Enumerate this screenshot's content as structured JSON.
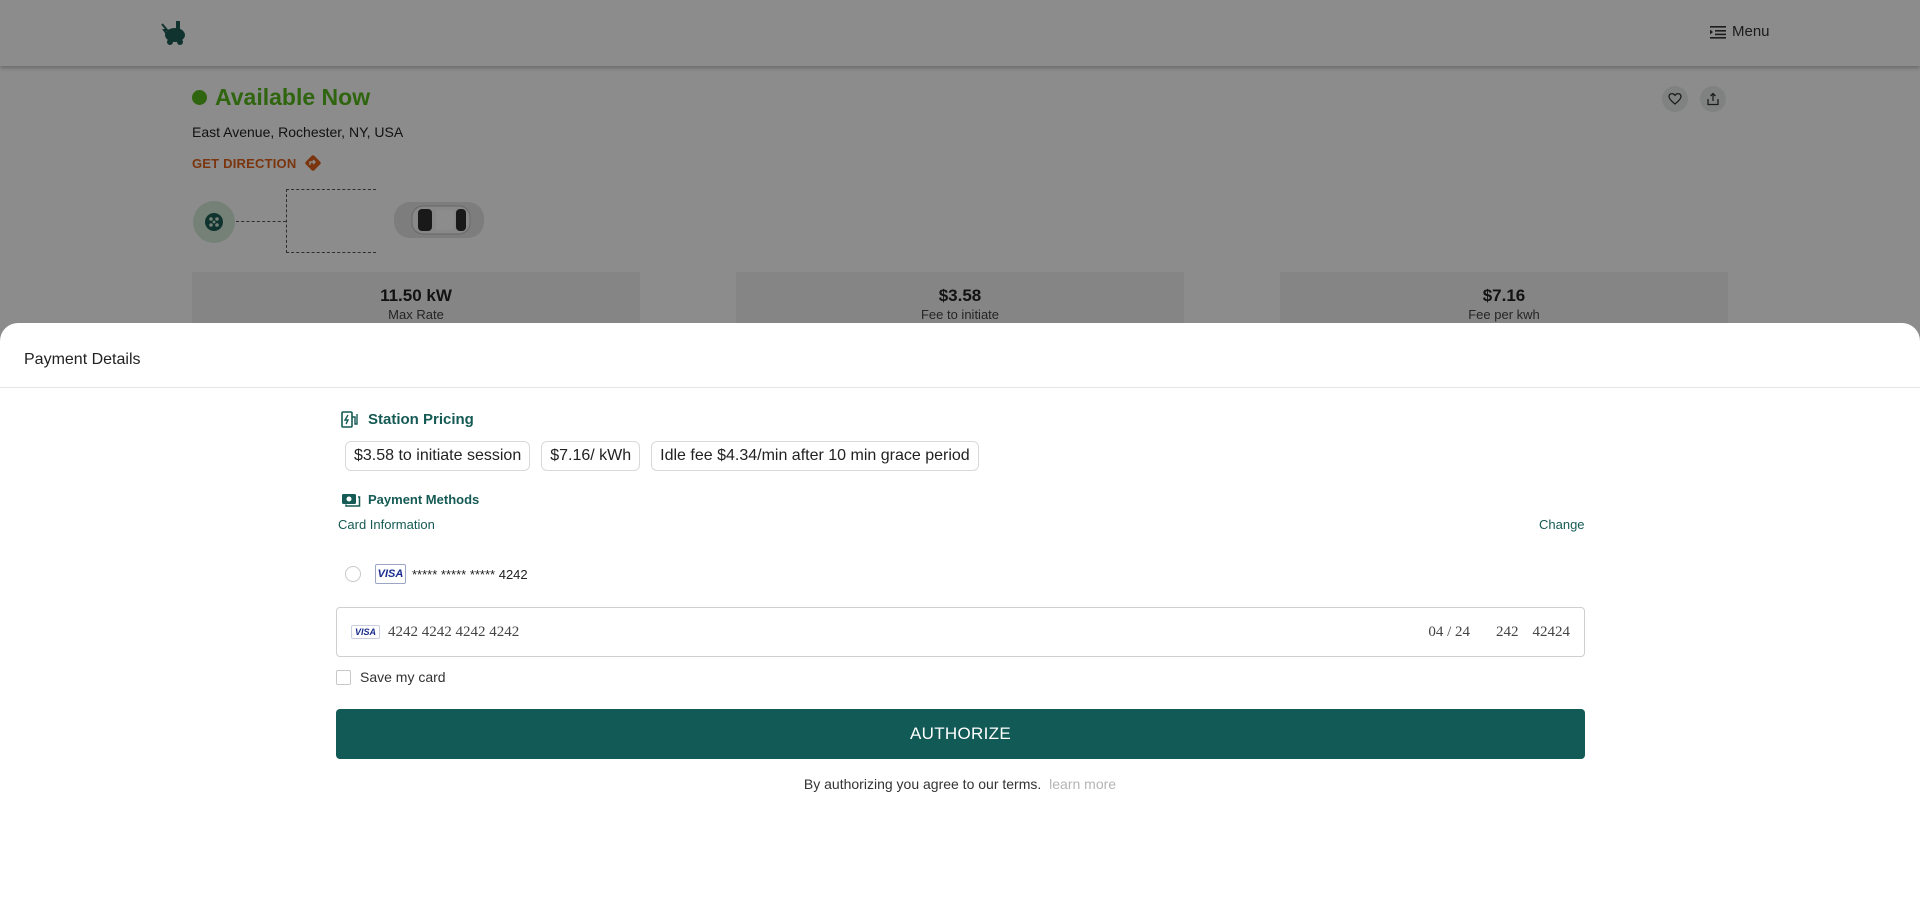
{
  "header": {
    "menu_label": "Menu",
    "icons": {
      "logo": "ev-charger-logo",
      "menu": "menu-lines-icon"
    }
  },
  "station": {
    "status": "Available Now",
    "address": "East Avenue, Rochester, NY, USA",
    "direction_label": "GET DIRECTION",
    "stats": [
      {
        "value": "11.50 kW",
        "label": "Max Rate"
      },
      {
        "value": "$3.58",
        "label": "Fee to initiate"
      },
      {
        "value": "$7.16",
        "label": "Fee per kwh"
      }
    ]
  },
  "payment": {
    "title": "Payment Details",
    "pricing_title": "Station Pricing",
    "pricing_chips": [
      "$3.58 to initiate session",
      "$7.16/ kWh",
      "Idle fee $4.34/min after 10 min grace period"
    ],
    "methods_title": "Payment Methods",
    "card_info_label": "Card Information",
    "change_label": "Change",
    "saved_card": {
      "brand": "VISA",
      "masked": "***** ***** ***** 4242"
    },
    "card_input": {
      "brand": "VISA",
      "number": "4242 4242 4242 4242",
      "expiry": "04 / 24",
      "cvc": "242",
      "zip": "42424"
    },
    "save_card_label": "Save my card",
    "authorize_label": "AUTHORIZE",
    "terms_text": "By authorizing you agree to our terms.",
    "learn_more": "learn more"
  },
  "colors": {
    "accent": "#115a55",
    "available": "#58b81c",
    "direction": "#e0611a",
    "overlay": "rgba(0,0,0,0.45)"
  }
}
